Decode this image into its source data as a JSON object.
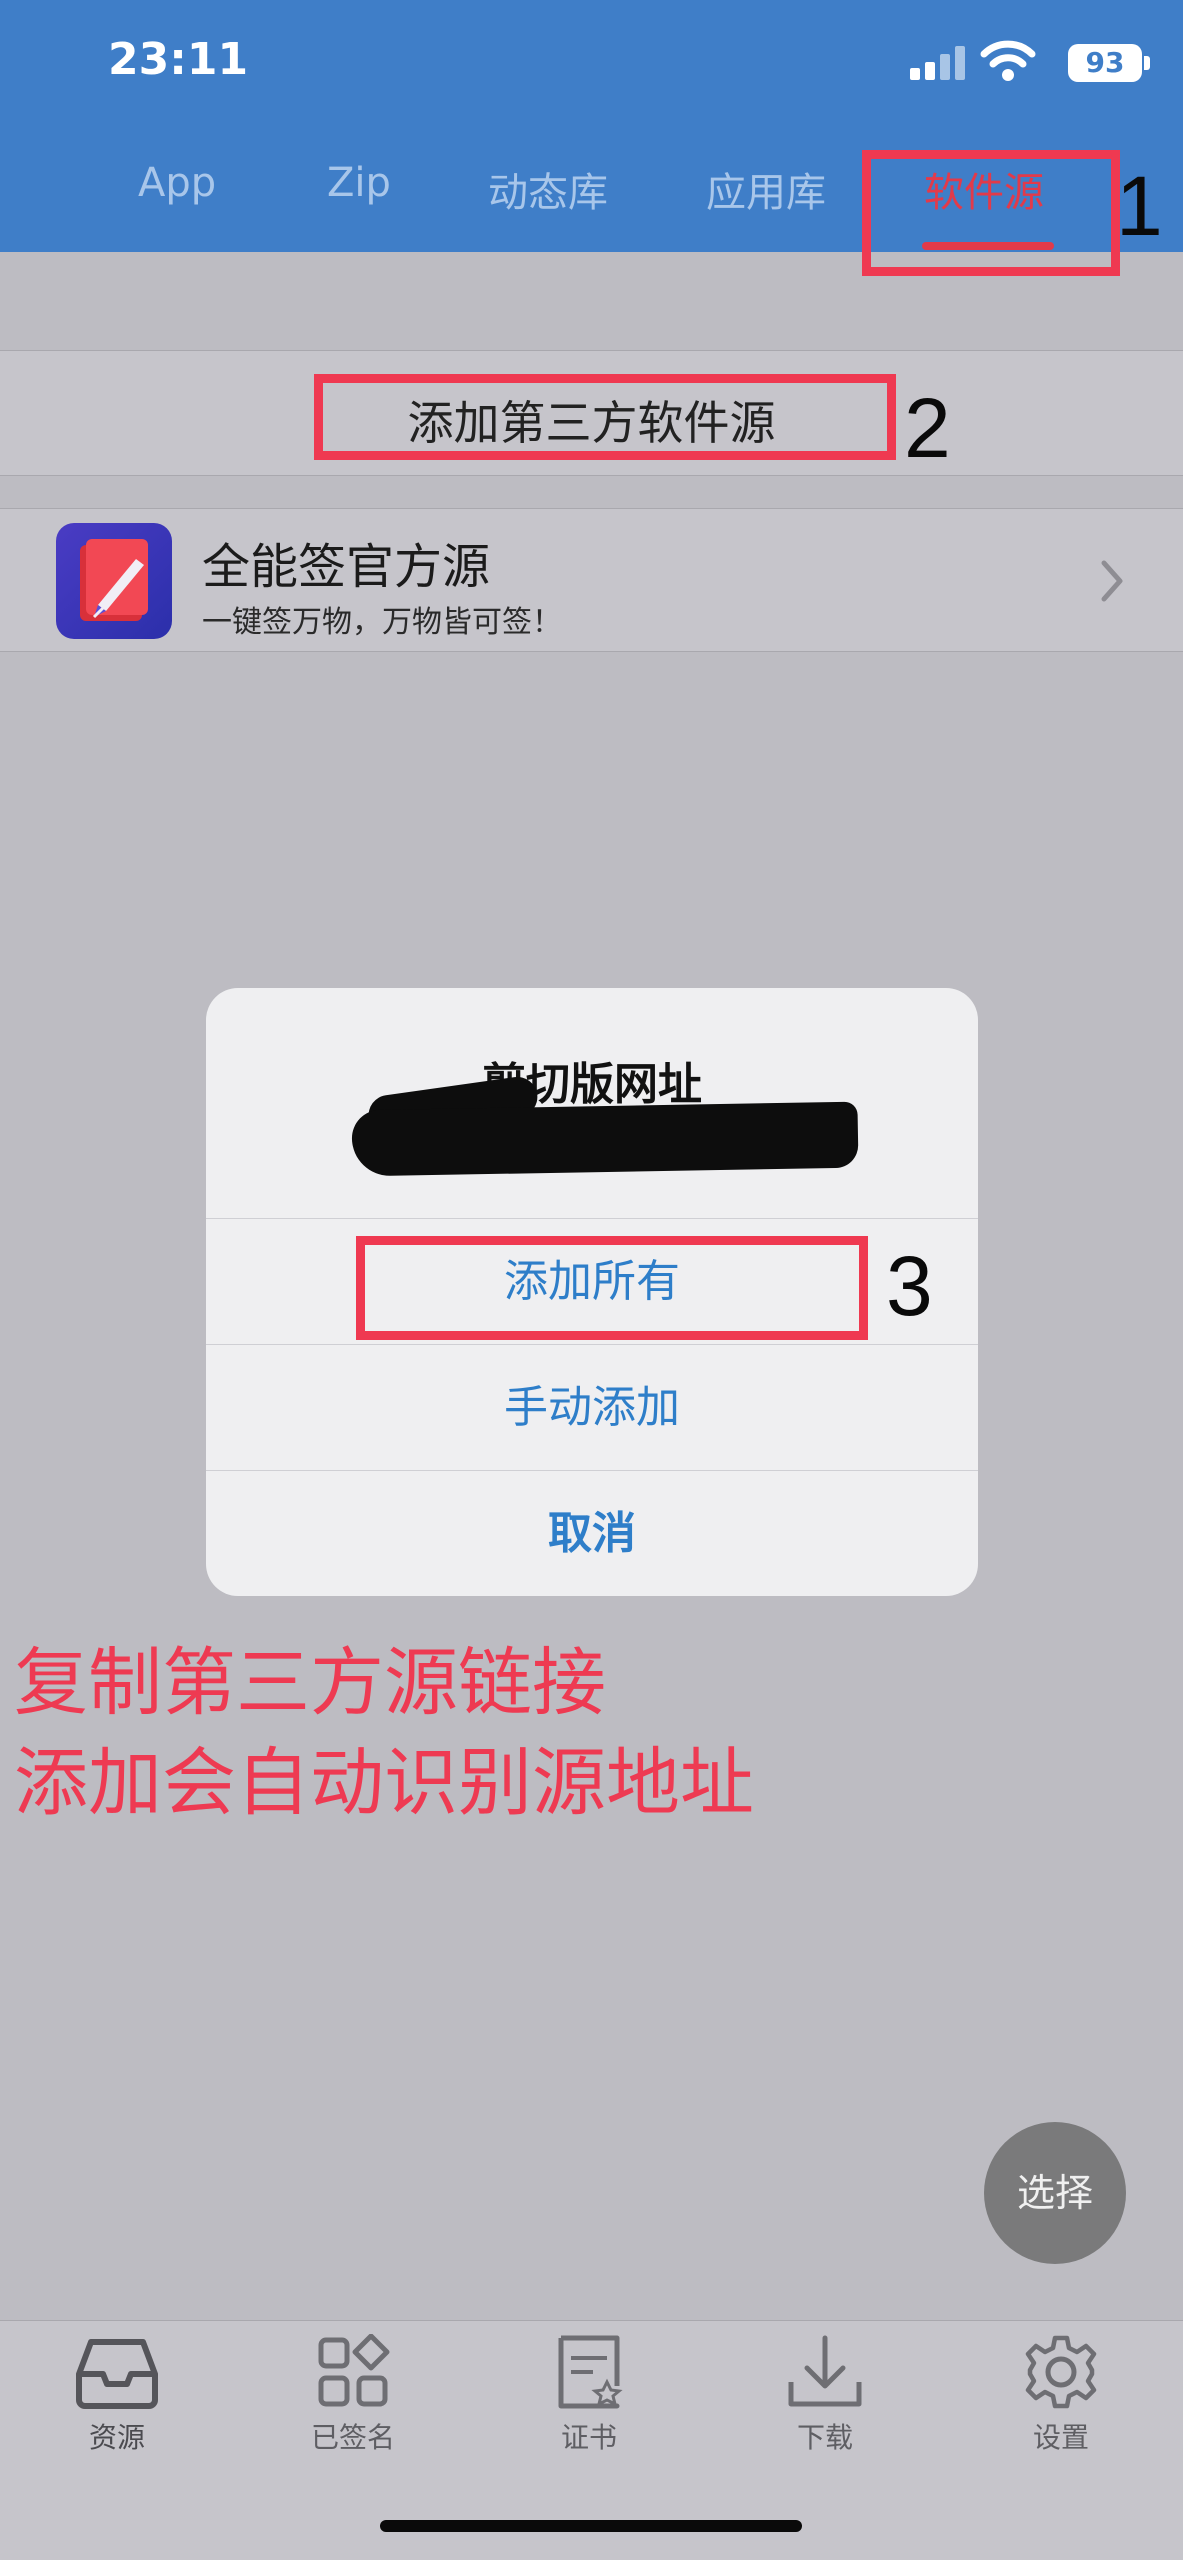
{
  "status_bar": {
    "time": "23:11",
    "battery": "93"
  },
  "tabs": [
    "App",
    "Zip",
    "动态库",
    "应用库",
    "软件源"
  ],
  "add_third_party": "添加第三方软件源",
  "source": {
    "title": "全能签官方源",
    "subtitle": "一键签万物，万物皆可签！"
  },
  "dialog": {
    "title": "剪切版网址",
    "buttons": [
      "添加所有",
      "手动添加",
      "取消"
    ]
  },
  "note_lines": [
    "复制第三方源链接",
    "添加会自动识别源地址"
  ],
  "annotations": [
    "1",
    "2",
    "3"
  ],
  "select_button": "选择",
  "bottom_tabs": [
    "资源",
    "已签名",
    "证书",
    "下载",
    "设置"
  ],
  "colors": {
    "header": "#3f7ec8",
    "accent_red": "#e23a4a",
    "dialog_button": "#2e7ec9",
    "note": "#ee3a52"
  }
}
